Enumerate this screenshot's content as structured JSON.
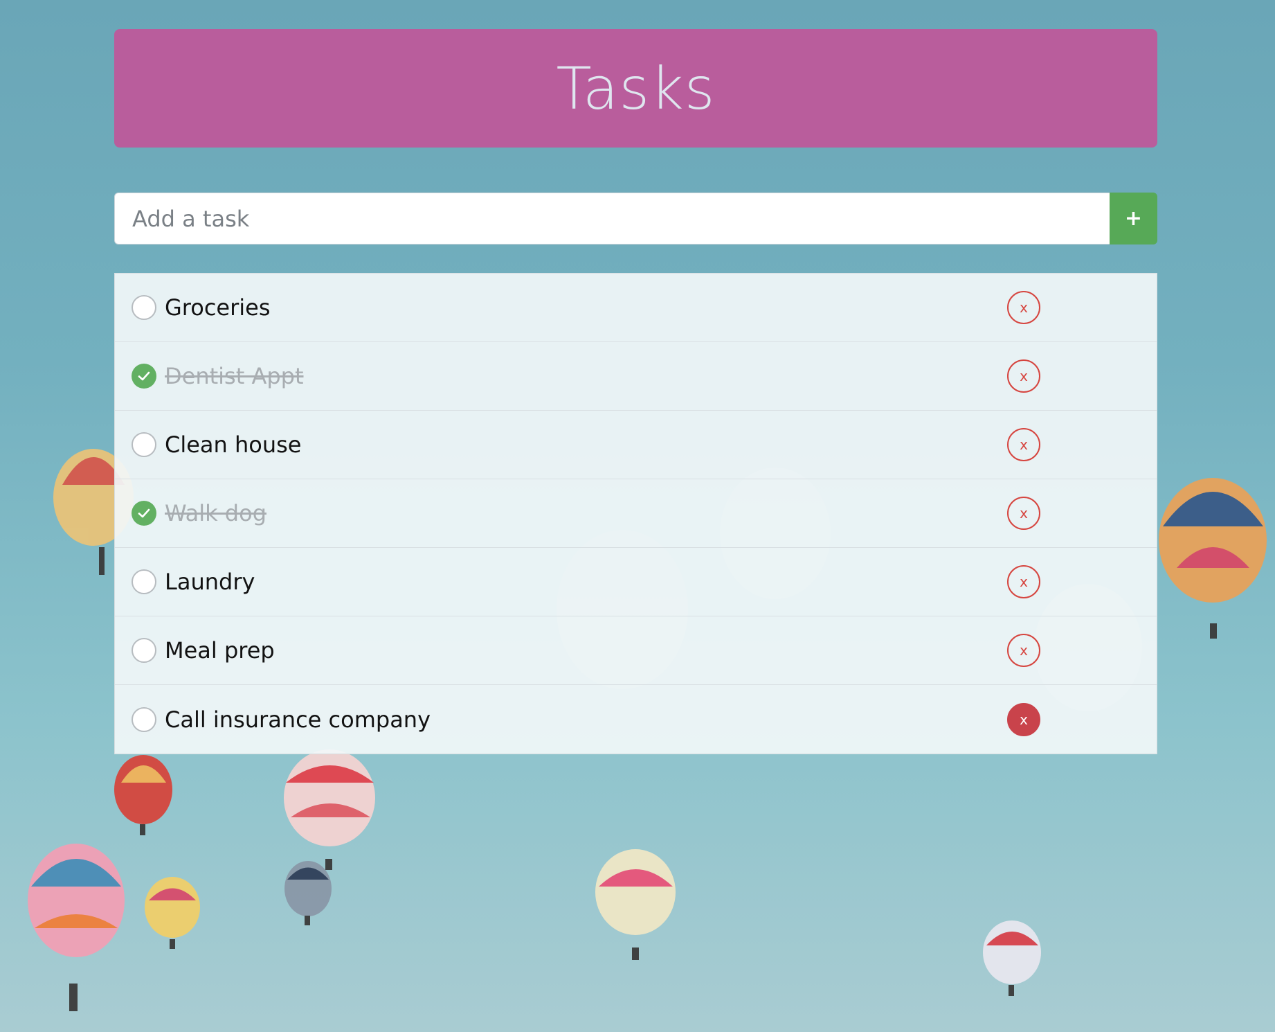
{
  "colors": {
    "header_bg": "#b95d9c",
    "add_button_bg": "#57a957",
    "check_done": "#62b062",
    "delete_outline": "#d6453f",
    "delete_filled": "#c9434b"
  },
  "header": {
    "title": "Tasks"
  },
  "add_form": {
    "placeholder": "Add a task",
    "value": "",
    "button_label": "+"
  },
  "tasks": [
    {
      "label": "Groceries",
      "done": false,
      "delete_label": "x"
    },
    {
      "label": "Dentist Appt",
      "done": true,
      "delete_label": "x"
    },
    {
      "label": "Clean house",
      "done": false,
      "delete_label": "x"
    },
    {
      "label": "Walk dog",
      "done": true,
      "delete_label": "x"
    },
    {
      "label": "Laundry",
      "done": false,
      "delete_label": "x"
    },
    {
      "label": "Meal prep",
      "done": false,
      "delete_label": "x"
    },
    {
      "label": "Call insurance company",
      "done": false,
      "delete_label": "x",
      "delete_hovered": true
    }
  ],
  "icons": {
    "check": "check-circle-icon",
    "empty": "empty-circle-icon",
    "delete": "x-circle-icon",
    "background": "hot-air-balloons-background"
  }
}
